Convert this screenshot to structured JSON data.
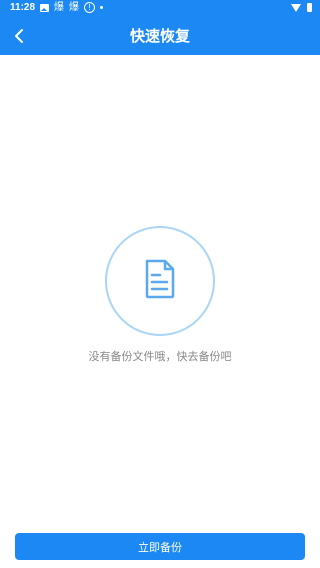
{
  "status_bar": {
    "time": "11:28",
    "glyph_1": "爆",
    "glyph_2": "爆",
    "alert": "!"
  },
  "header": {
    "title": "快速恢复",
    "back_icon": "chevron-left-icon"
  },
  "empty_state": {
    "icon": "document-icon",
    "message": "没有备份文件哦，快去备份吧"
  },
  "footer": {
    "backup_label": "立即备份"
  },
  "colors": {
    "primary": "#1b88f3",
    "circle_border": "#a9d5f7",
    "muted_text": "#888888"
  }
}
